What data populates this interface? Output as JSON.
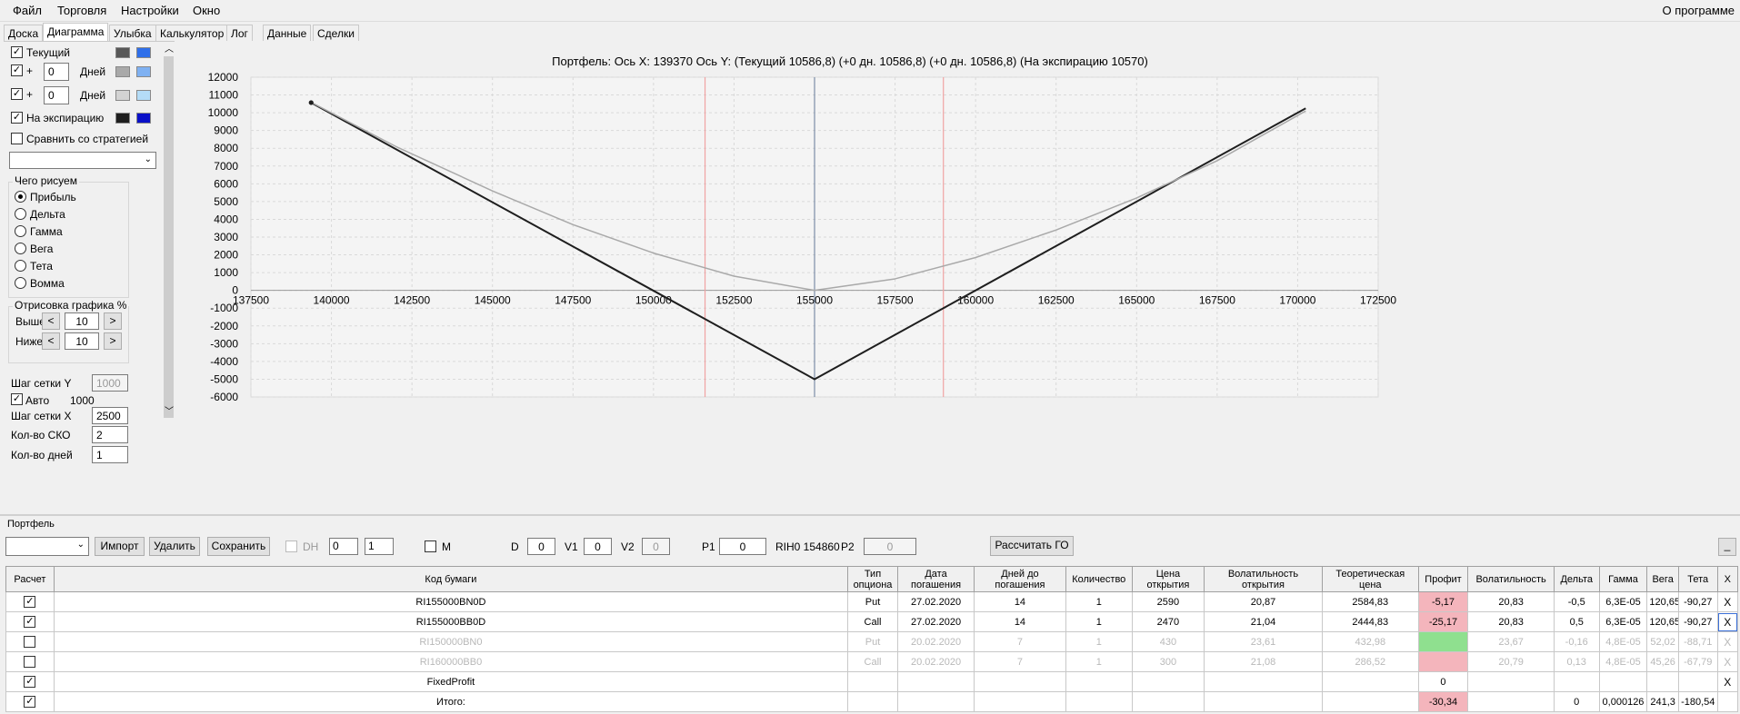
{
  "menu": {
    "items": [
      "Файл",
      "Торговля",
      "Настройки",
      "Окно"
    ],
    "about": "О программе"
  },
  "tabs": [
    "Доска",
    "Диаграмма",
    "Улыбка",
    "Калькулятор",
    "Лог",
    "Данные",
    "Сделки"
  ],
  "tabs_active": "Диаграмма",
  "left": {
    "current_label": "Текущий",
    "current_checked": true,
    "plus1": {
      "sign": "+",
      "days": "0",
      "unit": "Дней",
      "checked": true
    },
    "plus2": {
      "sign": "+",
      "days": "0",
      "unit": "Дней",
      "checked": true
    },
    "expiry_label": "На экспирацию",
    "expiry_checked": true,
    "compare_label": "Сравнить со стратегией",
    "compare_checked": false,
    "what_group": "Чего рисуем",
    "what_options": [
      "Прибыль",
      "Дельта",
      "Гамма",
      "Вега",
      "Тета",
      "Вомма"
    ],
    "what_selected": "Прибыль",
    "draw_group": "Отрисовка графика %",
    "above_label": "Выше",
    "above_value": "10",
    "below_label": "Ниже",
    "below_value": "10",
    "btn_left": "<",
    "btn_right": ">",
    "grid_y_label": "Шаг сетки Y",
    "grid_y_value": "1000",
    "auto_label": "Авто",
    "auto_value": "1000",
    "auto_checked": true,
    "grid_x_label": "Шаг сетки X",
    "grid_x_value": "2500",
    "sko_label": "Кол-во СКО",
    "sko_value": "2",
    "days_label": "Кол-во дней",
    "days_value": "1"
  },
  "colors": {
    "current": [
      "#585858",
      "#2f6fea"
    ],
    "plus1": [
      "#a9a9a9",
      "#7fb1f2"
    ],
    "plus2": [
      "#d3d3d3",
      "#b4dcf7"
    ],
    "expiry": [
      "#1e1e1e",
      "#0a10c8"
    ]
  },
  "chart_title": "Портфель: Ось X:  139370  Ось Y:   (Текущий 10586,8)   (+0 дн. 10586,8)   (+0 дн. 10586,8)   (На экспирацию 10570)",
  "chart_data": {
    "type": "line",
    "xlim": [
      137500,
      172500
    ],
    "ylim": [
      -6000,
      12000
    ],
    "x_ticks": [
      137500,
      140000,
      142500,
      145000,
      147500,
      150000,
      152500,
      155000,
      157500,
      160000,
      162500,
      165000,
      167500,
      170000,
      172500
    ],
    "y_ticks": [
      12000,
      11000,
      10000,
      9000,
      8000,
      7000,
      6000,
      5000,
      4000,
      3000,
      2000,
      1000,
      0,
      -1000,
      -2000,
      -3000,
      -4000,
      -5000,
      -6000
    ],
    "series": [
      {
        "color": "#1e1e1e",
        "points": [
          [
            139370,
            10570
          ],
          [
            155000,
            -5000
          ],
          [
            170250,
            10250
          ]
        ]
      },
      {
        "color": "#a9a9a9",
        "points": [
          [
            139370,
            10586.8
          ],
          [
            142000,
            8100
          ],
          [
            145000,
            5600
          ],
          [
            147500,
            3700
          ],
          [
            150000,
            2100
          ],
          [
            152500,
            800
          ],
          [
            155000,
            0
          ],
          [
            157500,
            650
          ],
          [
            160000,
            1850
          ],
          [
            162500,
            3400
          ],
          [
            165000,
            5200
          ],
          [
            167500,
            7300
          ],
          [
            170250,
            10100
          ]
        ]
      }
    ],
    "marker": [
      139370,
      10570
    ],
    "vlines": [
      {
        "x": 151600,
        "color": "#f0a3a3"
      },
      {
        "x": 155000,
        "color": "#7d8ea7"
      },
      {
        "x": 159000,
        "color": "#f0a3a3"
      }
    ]
  },
  "portfolio": {
    "label": "Портфель",
    "import_btn": "Импорт",
    "delete_btn": "Удалить",
    "save_btn": "Сохранить",
    "dh_label": "DH",
    "dh_v1": "0",
    "dh_v2": "1",
    "m_label": "M",
    "d_label": "D",
    "d_value": "0",
    "v1_label": "V1",
    "v1_value": "0",
    "v2_label": "V2",
    "v2_value": "0",
    "p1_label": "P1",
    "p1_value": "0",
    "ticker_label": "RIH0 154860",
    "p2_label": "P2",
    "p2_value": "0",
    "calc_btn": "Рассчитать ГО",
    "minimize": "_"
  },
  "table": {
    "headers": [
      "Расчет",
      "Код бумаги",
      "Тип опциона",
      "Дата погашения",
      "Дней до погашения",
      "Количество",
      "Цена открытия",
      "Волатильность открытия",
      "Теоретическая цена",
      "Профит",
      "Волатильность",
      "Дельта",
      "Гамма",
      "Вега",
      "Тета",
      "X"
    ],
    "rows": [
      {
        "checked": true,
        "code": "RI155000BN0D",
        "type": "Put",
        "date": "27.02.2020",
        "days": "14",
        "qty": "1",
        "open": "2590",
        "vol_open": "20,87",
        "theo": "2584,83",
        "profit": "-5,17",
        "profit_color": "#f4b5bc",
        "vol": "20,83",
        "delta": "-0,5",
        "gamma": "6,3E-05",
        "vega": "120,65",
        "theta": "-90,27",
        "x": "X",
        "dim": false
      },
      {
        "checked": true,
        "code": "RI155000BB0D",
        "type": "Call",
        "date": "27.02.2020",
        "days": "14",
        "qty": "1",
        "open": "2470",
        "vol_open": "21,04",
        "theo": "2444,83",
        "profit": "-25,17",
        "profit_color": "#f4b5bc",
        "vol": "20,83",
        "delta": "0,5",
        "gamma": "6,3E-05",
        "vega": "120,65",
        "theta": "-90,27",
        "x": "X",
        "dim": false
      },
      {
        "checked": false,
        "code": "RI150000BN0",
        "type": "Put",
        "date": "20.02.2020",
        "days": "7",
        "qty": "1",
        "open": "430",
        "vol_open": "23,61",
        "theo": "432,98",
        "profit": "",
        "profit_color": "#8fe08f",
        "vol": "23,67",
        "delta": "-0,16",
        "gamma": "4,8E-05",
        "vega": "52,02",
        "theta": "-88,71",
        "x": "X",
        "dim": true
      },
      {
        "checked": false,
        "code": "RI160000BB0",
        "type": "Call",
        "date": "20.02.2020",
        "days": "7",
        "qty": "1",
        "open": "300",
        "vol_open": "21,08",
        "theo": "286,52",
        "profit": "",
        "profit_color": "#f4b5bc",
        "vol": "20,79",
        "delta": "0,13",
        "gamma": "4,8E-05",
        "vega": "45,26",
        "theta": "-67,79",
        "x": "X",
        "dim": true
      },
      {
        "checked": true,
        "code": "FixedProfit",
        "type": "",
        "date": "",
        "days": "",
        "qty": "",
        "open": "",
        "vol_open": "",
        "theo": "",
        "profit": "0",
        "profit_color": "#ffffff",
        "vol": "",
        "delta": "",
        "gamma": "",
        "vega": "",
        "theta": "",
        "x": "X",
        "dim": false
      },
      {
        "checked": true,
        "code": "Итого:",
        "type": "",
        "date": "",
        "days": "",
        "qty": "",
        "open": "",
        "vol_open": "",
        "theo": "",
        "profit": "-30,34",
        "profit_color": "#f4b5bc",
        "vol": "",
        "delta": "0",
        "gamma": "0,000126",
        "vega": "241,3",
        "theta": "-180,54",
        "x": "",
        "dim": false
      }
    ]
  }
}
